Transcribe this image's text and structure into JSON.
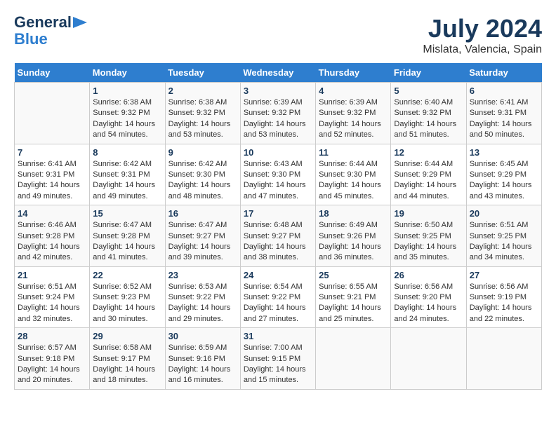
{
  "header": {
    "logo_line1": "General",
    "logo_line2": "Blue",
    "title": "July 2024",
    "subtitle": "Mislata, Valencia, Spain"
  },
  "calendar": {
    "days": [
      "Sunday",
      "Monday",
      "Tuesday",
      "Wednesday",
      "Thursday",
      "Friday",
      "Saturday"
    ],
    "weeks": [
      [
        {
          "date": "",
          "text": ""
        },
        {
          "date": "1",
          "text": "Sunrise: 6:38 AM\nSunset: 9:32 PM\nDaylight: 14 hours\nand 54 minutes."
        },
        {
          "date": "2",
          "text": "Sunrise: 6:38 AM\nSunset: 9:32 PM\nDaylight: 14 hours\nand 53 minutes."
        },
        {
          "date": "3",
          "text": "Sunrise: 6:39 AM\nSunset: 9:32 PM\nDaylight: 14 hours\nand 53 minutes."
        },
        {
          "date": "4",
          "text": "Sunrise: 6:39 AM\nSunset: 9:32 PM\nDaylight: 14 hours\nand 52 minutes."
        },
        {
          "date": "5",
          "text": "Sunrise: 6:40 AM\nSunset: 9:32 PM\nDaylight: 14 hours\nand 51 minutes."
        },
        {
          "date": "6",
          "text": "Sunrise: 6:41 AM\nSunset: 9:31 PM\nDaylight: 14 hours\nand 50 minutes."
        }
      ],
      [
        {
          "date": "7",
          "text": "Sunrise: 6:41 AM\nSunset: 9:31 PM\nDaylight: 14 hours\nand 49 minutes."
        },
        {
          "date": "8",
          "text": "Sunrise: 6:42 AM\nSunset: 9:31 PM\nDaylight: 14 hours\nand 49 minutes."
        },
        {
          "date": "9",
          "text": "Sunrise: 6:42 AM\nSunset: 9:30 PM\nDaylight: 14 hours\nand 48 minutes."
        },
        {
          "date": "10",
          "text": "Sunrise: 6:43 AM\nSunset: 9:30 PM\nDaylight: 14 hours\nand 47 minutes."
        },
        {
          "date": "11",
          "text": "Sunrise: 6:44 AM\nSunset: 9:30 PM\nDaylight: 14 hours\nand 45 minutes."
        },
        {
          "date": "12",
          "text": "Sunrise: 6:44 AM\nSunset: 9:29 PM\nDaylight: 14 hours\nand 44 minutes."
        },
        {
          "date": "13",
          "text": "Sunrise: 6:45 AM\nSunset: 9:29 PM\nDaylight: 14 hours\nand 43 minutes."
        }
      ],
      [
        {
          "date": "14",
          "text": "Sunrise: 6:46 AM\nSunset: 9:28 PM\nDaylight: 14 hours\nand 42 minutes."
        },
        {
          "date": "15",
          "text": "Sunrise: 6:47 AM\nSunset: 9:28 PM\nDaylight: 14 hours\nand 41 minutes."
        },
        {
          "date": "16",
          "text": "Sunrise: 6:47 AM\nSunset: 9:27 PM\nDaylight: 14 hours\nand 39 minutes."
        },
        {
          "date": "17",
          "text": "Sunrise: 6:48 AM\nSunset: 9:27 PM\nDaylight: 14 hours\nand 38 minutes."
        },
        {
          "date": "18",
          "text": "Sunrise: 6:49 AM\nSunset: 9:26 PM\nDaylight: 14 hours\nand 36 minutes."
        },
        {
          "date": "19",
          "text": "Sunrise: 6:50 AM\nSunset: 9:25 PM\nDaylight: 14 hours\nand 35 minutes."
        },
        {
          "date": "20",
          "text": "Sunrise: 6:51 AM\nSunset: 9:25 PM\nDaylight: 14 hours\nand 34 minutes."
        }
      ],
      [
        {
          "date": "21",
          "text": "Sunrise: 6:51 AM\nSunset: 9:24 PM\nDaylight: 14 hours\nand 32 minutes."
        },
        {
          "date": "22",
          "text": "Sunrise: 6:52 AM\nSunset: 9:23 PM\nDaylight: 14 hours\nand 30 minutes."
        },
        {
          "date": "23",
          "text": "Sunrise: 6:53 AM\nSunset: 9:22 PM\nDaylight: 14 hours\nand 29 minutes."
        },
        {
          "date": "24",
          "text": "Sunrise: 6:54 AM\nSunset: 9:22 PM\nDaylight: 14 hours\nand 27 minutes."
        },
        {
          "date": "25",
          "text": "Sunrise: 6:55 AM\nSunset: 9:21 PM\nDaylight: 14 hours\nand 25 minutes."
        },
        {
          "date": "26",
          "text": "Sunrise: 6:56 AM\nSunset: 9:20 PM\nDaylight: 14 hours\nand 24 minutes."
        },
        {
          "date": "27",
          "text": "Sunrise: 6:56 AM\nSunset: 9:19 PM\nDaylight: 14 hours\nand 22 minutes."
        }
      ],
      [
        {
          "date": "28",
          "text": "Sunrise: 6:57 AM\nSunset: 9:18 PM\nDaylight: 14 hours\nand 20 minutes."
        },
        {
          "date": "29",
          "text": "Sunrise: 6:58 AM\nSunset: 9:17 PM\nDaylight: 14 hours\nand 18 minutes."
        },
        {
          "date": "30",
          "text": "Sunrise: 6:59 AM\nSunset: 9:16 PM\nDaylight: 14 hours\nand 16 minutes."
        },
        {
          "date": "31",
          "text": "Sunrise: 7:00 AM\nSunset: 9:15 PM\nDaylight: 14 hours\nand 15 minutes."
        },
        {
          "date": "",
          "text": ""
        },
        {
          "date": "",
          "text": ""
        },
        {
          "date": "",
          "text": ""
        }
      ]
    ]
  }
}
